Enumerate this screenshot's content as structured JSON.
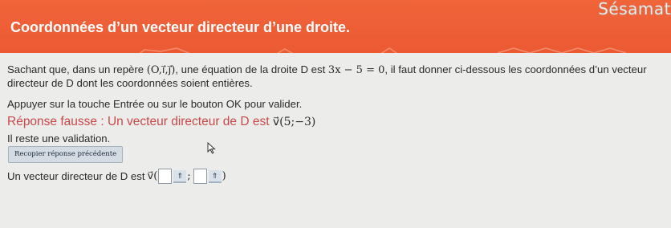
{
  "header": {
    "title": "Coordonnées d’un vecteur directeur d’une droite.",
    "brand": "Sésamat"
  },
  "question": {
    "line1_start": "Sachant que, dans un repère ",
    "repere": "(O,i⃗,j⃗)",
    "line1_mid": ", une équation de la droite D est ",
    "equation": "3x − 5 = 0",
    "line1_end": ", il faut donner ci-dessous les coordonnées d’un vecteur",
    "line2": "directeur de D dont les coordonnées soient entières.",
    "instruction": "Appuyer sur la touche Entrée ou sur le bouton OK pour valider."
  },
  "feedback": {
    "error_text": "Réponse fausse : Un vecteur directeur de D est ",
    "error_vector": "v⃗(5;−3)",
    "remaining": "Il reste une validation."
  },
  "recopy_button": {
    "label": "Recopier réponse précédente"
  },
  "answer": {
    "prefix": "Un vecteur directeur de D est ",
    "vector_open": "v⃗(",
    "separator": ";",
    "close": ")",
    "x_value": "",
    "y_value": "",
    "keyboard_icon": "⇑"
  },
  "colors": {
    "header": "#ec5a33",
    "error": "#c9484a",
    "button_bg": "#d4dbe3"
  }
}
